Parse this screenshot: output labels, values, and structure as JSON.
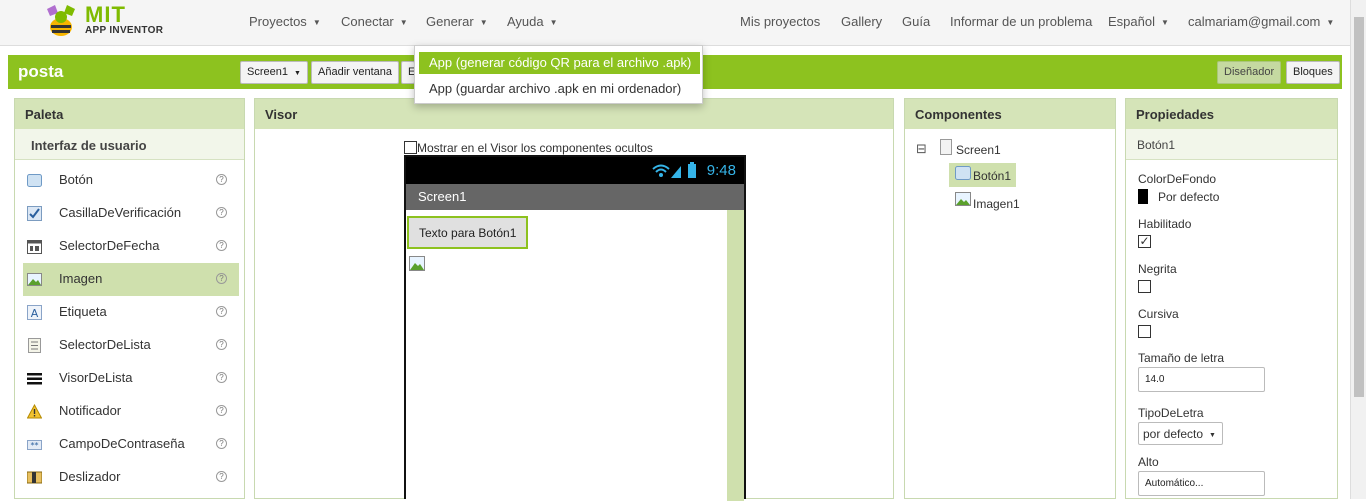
{
  "topbar": {
    "logo_mit": "MIT",
    "logo_app_inventor": "APP INVENTOR",
    "menu_left": [
      "Proyectos",
      "Conectar",
      "Generar",
      "Ayuda"
    ],
    "menu_right": {
      "mis_proyectos": "Mis proyectos",
      "gallery": "Gallery",
      "guia": "Guía",
      "report": "Informar de un problema",
      "language": "Español",
      "user": "calmariam@gmail.com"
    }
  },
  "project_bar": {
    "name": "posta",
    "screen_select": "Screen1",
    "add_screen": "Añadir ventana",
    "partial_button": "E",
    "designer": "Diseñador",
    "blocks": "Bloques"
  },
  "generate_menu": {
    "items": [
      "App (generar código QR para el archivo .apk)",
      "App (guardar archivo .apk en mi ordenador)"
    ]
  },
  "palette": {
    "title": "Paleta",
    "category": "Interfaz de usuario",
    "items": [
      {
        "label": "Botón",
        "icon": "button-icon"
      },
      {
        "label": "CasillaDeVerificación",
        "icon": "checkbox-icon"
      },
      {
        "label": "SelectorDeFecha",
        "icon": "datepicker-icon"
      },
      {
        "label": "Imagen",
        "icon": "image-icon"
      },
      {
        "label": "Etiqueta",
        "icon": "label-icon"
      },
      {
        "label": "SelectorDeLista",
        "icon": "listpicker-icon"
      },
      {
        "label": "VisorDeLista",
        "icon": "listview-icon"
      },
      {
        "label": "Notificador",
        "icon": "warning-icon"
      },
      {
        "label": "CampoDeContraseña",
        "icon": "password-icon"
      },
      {
        "label": "Deslizador",
        "icon": "slider-icon"
      }
    ],
    "help_glyph": "?"
  },
  "viewer": {
    "title": "Visor",
    "show_hidden": "Mostrar en el Visor los componentes ocultos",
    "clock": "9:48",
    "screen_title": "Screen1",
    "button_text": "Texto para Botón1"
  },
  "components": {
    "title": "Componentes",
    "tree": [
      "Screen1",
      "Botón1",
      "Imagen1"
    ],
    "collapse_glyph": "⊟"
  },
  "properties": {
    "title": "Propiedades",
    "component": "Botón1",
    "bg_color_label": "ColorDeFondo",
    "bg_color_value": "Por defecto",
    "enabled_label": "Habilitado",
    "enabled_check": "✓",
    "bold_label": "Negrita",
    "italic_label": "Cursiva",
    "font_size_label": "Tamaño de letra",
    "font_size_value": "14.0",
    "font_type_label": "TipoDeLetra",
    "font_type_value": "por defecto",
    "height_label": "Alto",
    "height_value": "Automático..."
  },
  "colors": {
    "accent": "#8dc21f",
    "panel_header": "#d5e4b8",
    "selection": "#cfe0ad"
  }
}
